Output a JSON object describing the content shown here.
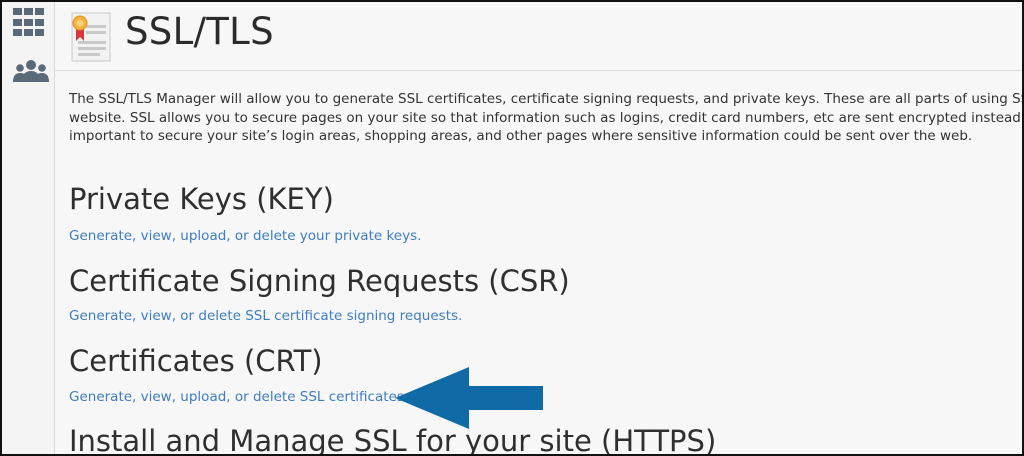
{
  "header": {
    "title": "SSL/TLS"
  },
  "intro": {
    "lines": [
      "The SSL/TLS Manager will allow you to generate SSL certificates, certificate signing requests, and private keys. These are all parts of using SSL to sec",
      "website. SSL allows you to secure pages on your site so that information such as logins, credit card numbers, etc are sent encrypted instead of plair",
      "important to secure your site’s login areas, shopping areas, and other pages where sensitive information could be sent over the web."
    ]
  },
  "sections": [
    {
      "title": "Private Keys (KEY)",
      "link": "Generate, view, upload, or delete your private keys."
    },
    {
      "title": "Certificate Signing Requests (CSR)",
      "link": "Generate, view, or delete SSL certificate signing requests."
    },
    {
      "title": "Certificates (CRT)",
      "link": "Generate, view, upload, or delete SSL certificates."
    },
    {
      "title": "Install and Manage SSL for your site (HTTPS)"
    }
  ],
  "colors": {
    "link": "#3d7dc3",
    "arrow": "#0f6aa6",
    "sidebar_icon": "#5a6a78"
  },
  "icons": {
    "sidebar_top": "grid-icon",
    "sidebar_second": "users-icon",
    "header": "certificate-icon",
    "annotation": "arrow-left-icon"
  }
}
